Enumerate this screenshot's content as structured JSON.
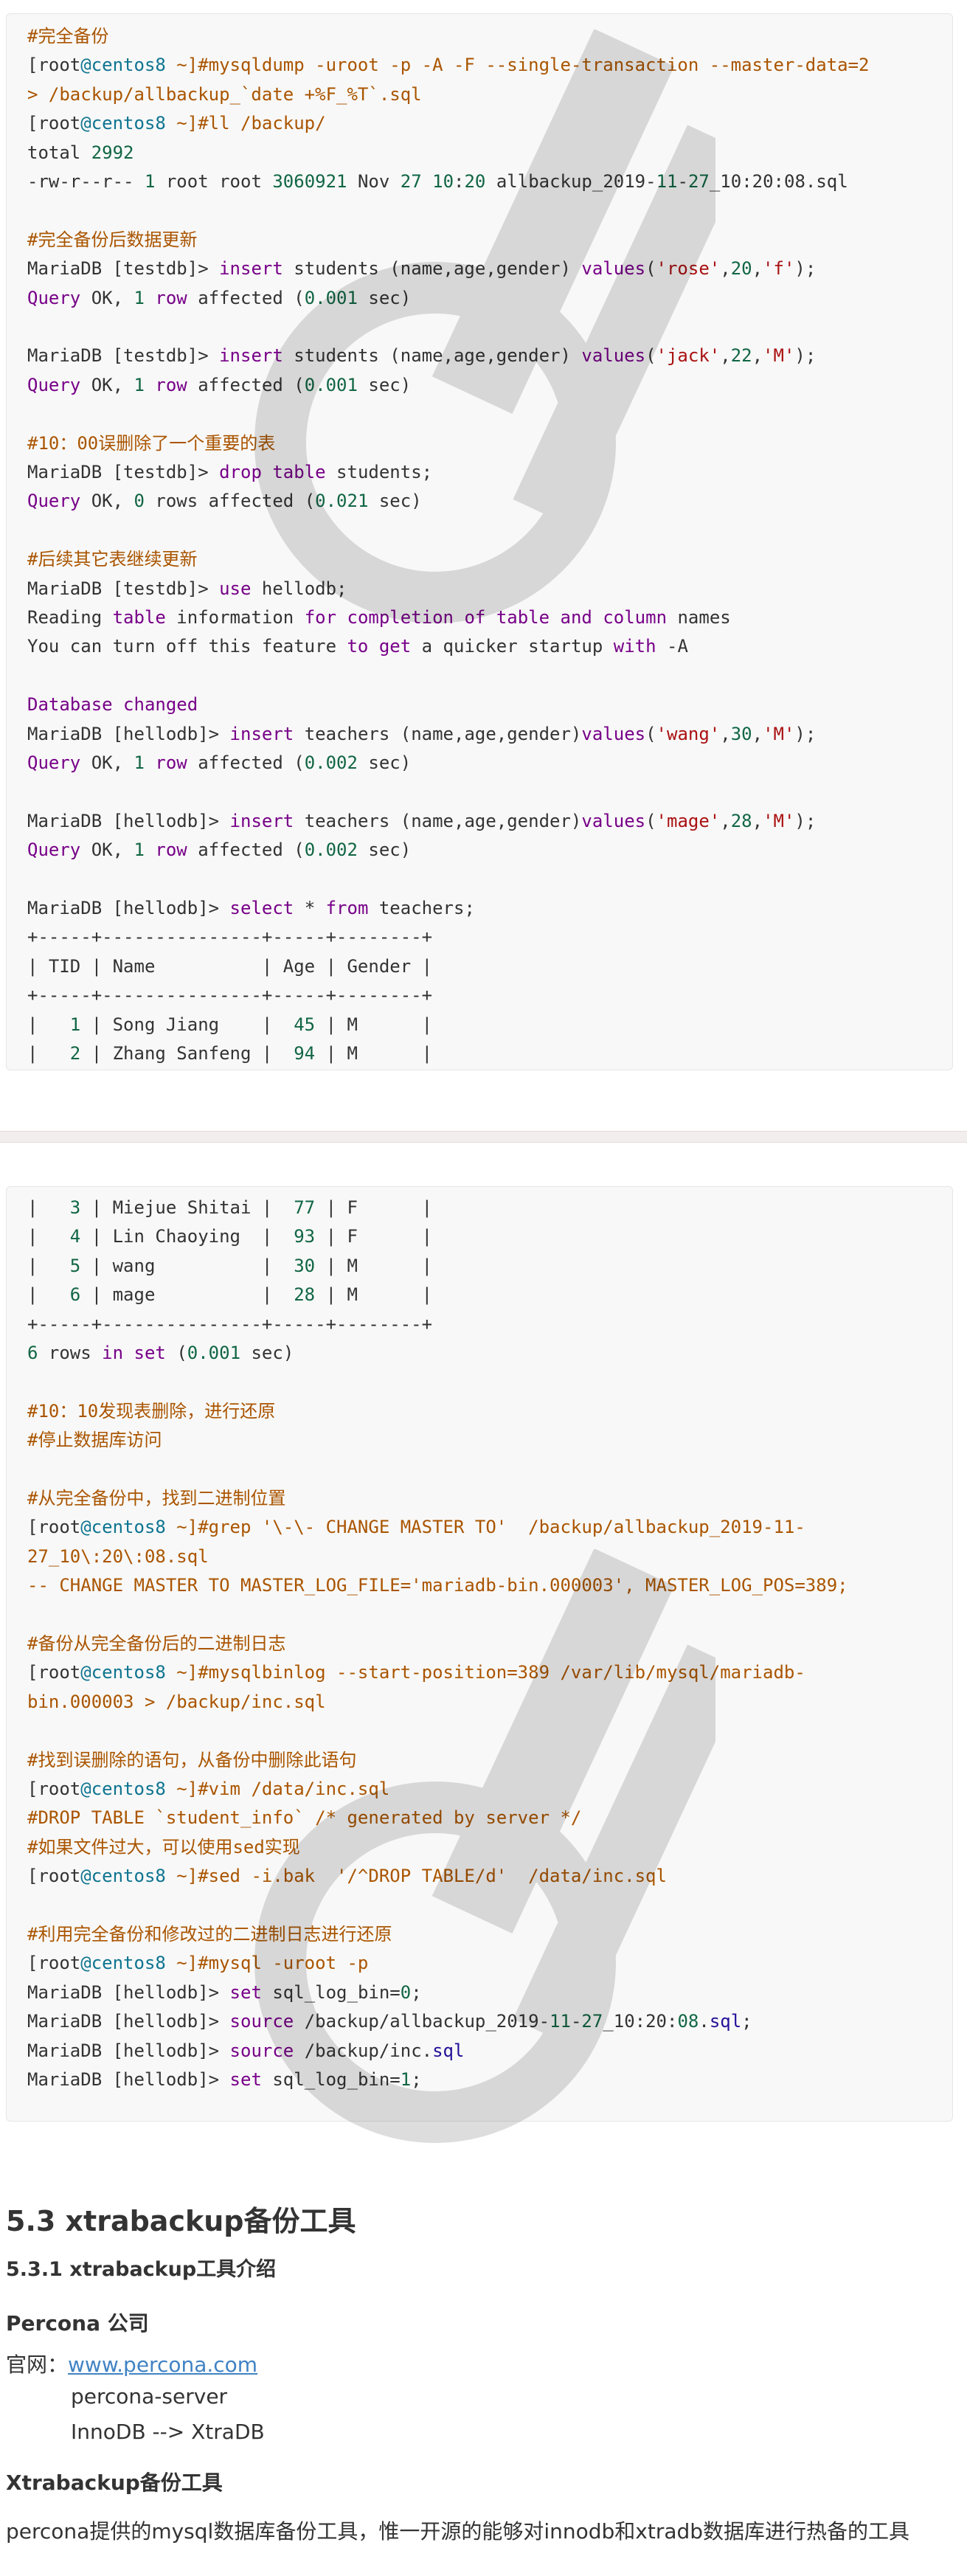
{
  "code_block_1": {
    "lines": [
      [
        [
          "c",
          "#完全备份"
        ]
      ],
      [
        [
          "",
          "[root"
        ],
        [
          "d",
          "@centos8"
        ],
        [
          "c",
          " ~]#mysqldump -uroot -p -A -F --single-transaction --master-data=2"
        ]
      ],
      [
        [
          "c",
          "> /backup/allbackup_`date +%F_%T`.sql"
        ]
      ],
      [
        [
          "",
          "[root"
        ],
        [
          "d",
          "@centos8"
        ],
        [
          "c",
          " ~]#ll /backup/"
        ]
      ],
      [
        [
          "",
          "total "
        ],
        [
          "n",
          "2992"
        ]
      ],
      [
        [
          "",
          "-rw-r--r-- "
        ],
        [
          "n",
          "1"
        ],
        [
          "",
          " root root "
        ],
        [
          "n",
          "3060921"
        ],
        [
          "",
          " Nov "
        ],
        [
          "n",
          "27"
        ],
        [
          "",
          " "
        ],
        [
          "n",
          "10"
        ],
        [
          "",
          ":"
        ],
        [
          "n",
          "20"
        ],
        [
          "",
          " allbackup_2019-"
        ],
        [
          "n",
          "11"
        ],
        [
          "",
          "-"
        ],
        [
          "n",
          "27"
        ],
        [
          "",
          "_10:20:08.sql"
        ]
      ],
      [
        [
          "",
          ""
        ]
      ],
      [
        [
          "c",
          "#完全备份后数据更新"
        ]
      ],
      [
        [
          "",
          "MariaDB [testdb]> "
        ],
        [
          "k",
          "insert"
        ],
        [
          "",
          " students (name,age,gender) "
        ],
        [
          "k",
          "values"
        ],
        [
          "",
          "("
        ],
        [
          "s",
          "'rose'"
        ],
        [
          "",
          ","
        ],
        [
          "n",
          "20"
        ],
        [
          "",
          ","
        ],
        [
          "s",
          "'f'"
        ],
        [
          "",
          ");"
        ]
      ],
      [
        [
          "k",
          "Query"
        ],
        [
          "",
          " OK, "
        ],
        [
          "n",
          "1"
        ],
        [
          "",
          ""
        ],
        [
          "k",
          " row"
        ],
        [
          "",
          " affected ("
        ],
        [
          "n",
          "0.001"
        ],
        [
          "",
          " sec)"
        ]
      ],
      [
        [
          "",
          ""
        ]
      ],
      [
        [
          "",
          "MariaDB [testdb]> "
        ],
        [
          "k",
          "insert"
        ],
        [
          "",
          " students (name,age,gender) "
        ],
        [
          "k",
          "values"
        ],
        [
          "",
          "("
        ],
        [
          "s",
          "'jack'"
        ],
        [
          "",
          ","
        ],
        [
          "n",
          "22"
        ],
        [
          "",
          ","
        ],
        [
          "s",
          "'M'"
        ],
        [
          "",
          ");"
        ]
      ],
      [
        [
          "k",
          "Query"
        ],
        [
          "",
          " OK, "
        ],
        [
          "n",
          "1"
        ],
        [
          "k",
          " row"
        ],
        [
          "",
          " affected ("
        ],
        [
          "n",
          "0.001"
        ],
        [
          "",
          " sec)"
        ]
      ],
      [
        [
          "",
          ""
        ]
      ],
      [
        [
          "c",
          "#10：00误删除了一个重要的表"
        ]
      ],
      [
        [
          "",
          "MariaDB [testdb]> "
        ],
        [
          "k",
          "drop"
        ],
        [
          "",
          " "
        ],
        [
          "k",
          "table"
        ],
        [
          "",
          " students;"
        ]
      ],
      [
        [
          "k",
          "Query"
        ],
        [
          "",
          " OK, "
        ],
        [
          "n",
          "0"
        ],
        [
          "",
          " rows affected ("
        ],
        [
          "n",
          "0.021"
        ],
        [
          "",
          " sec)"
        ]
      ],
      [
        [
          "",
          ""
        ]
      ],
      [
        [
          "c",
          "#后续其它表继续更新"
        ]
      ],
      [
        [
          "",
          "MariaDB [testdb]> "
        ],
        [
          "k",
          "use"
        ],
        [
          "",
          " hellodb;"
        ]
      ],
      [
        [
          "",
          "Reading "
        ],
        [
          "k",
          "table"
        ],
        [
          "",
          " information "
        ],
        [
          "k",
          "for"
        ],
        [
          "",
          " "
        ],
        [
          "k",
          "completion"
        ],
        [
          "",
          " "
        ],
        [
          "k",
          "of"
        ],
        [
          "",
          " "
        ],
        [
          "k",
          "table"
        ],
        [
          "",
          " "
        ],
        [
          "k",
          "and"
        ],
        [
          "",
          " "
        ],
        [
          "k",
          "column"
        ],
        [
          "",
          " names"
        ]
      ],
      [
        [
          "",
          "You can turn off this feature "
        ],
        [
          "k",
          "to"
        ],
        [
          "",
          " "
        ],
        [
          "k",
          "get"
        ],
        [
          "",
          " a quicker startup "
        ],
        [
          "k",
          "with"
        ],
        [
          "",
          " -A"
        ]
      ],
      [
        [
          "",
          ""
        ]
      ],
      [
        [
          "k",
          "Database"
        ],
        [
          "",
          " "
        ],
        [
          "k",
          "changed"
        ]
      ],
      [
        [
          "",
          "MariaDB [hellodb]> "
        ],
        [
          "k",
          "insert"
        ],
        [
          "",
          " teachers (name,age,gender)"
        ],
        [
          "k",
          "values"
        ],
        [
          "",
          "("
        ],
        [
          "s",
          "'wang'"
        ],
        [
          "",
          ","
        ],
        [
          "n",
          "30"
        ],
        [
          "",
          ","
        ],
        [
          "s",
          "'M'"
        ],
        [
          "",
          ");"
        ]
      ],
      [
        [
          "k",
          "Query"
        ],
        [
          "",
          " OK, "
        ],
        [
          "n",
          "1"
        ],
        [
          "k",
          " row"
        ],
        [
          "",
          " affected ("
        ],
        [
          "n",
          "0.002"
        ],
        [
          "",
          " sec)"
        ]
      ],
      [
        [
          "",
          ""
        ]
      ],
      [
        [
          "",
          "MariaDB [hellodb]> "
        ],
        [
          "k",
          "insert"
        ],
        [
          "",
          " teachers (name,age,gender)"
        ],
        [
          "k",
          "values"
        ],
        [
          "",
          "("
        ],
        [
          "s",
          "'mage'"
        ],
        [
          "",
          ","
        ],
        [
          "n",
          "28"
        ],
        [
          "",
          ","
        ],
        [
          "s",
          "'M'"
        ],
        [
          "",
          ");"
        ]
      ],
      [
        [
          "k",
          "Query"
        ],
        [
          "",
          " OK, "
        ],
        [
          "n",
          "1"
        ],
        [
          "k",
          " row"
        ],
        [
          "",
          " affected ("
        ],
        [
          "n",
          "0.002"
        ],
        [
          "",
          " sec)"
        ]
      ],
      [
        [
          "",
          ""
        ]
      ],
      [
        [
          "",
          "MariaDB [hellodb]> "
        ],
        [
          "k",
          "select"
        ],
        [
          "",
          " * "
        ],
        [
          "k",
          "from"
        ],
        [
          "",
          " teachers;"
        ]
      ],
      [
        [
          "",
          "+-----+---------------+-----+--------+"
        ]
      ],
      [
        [
          "",
          "| TID | Name          | Age | Gender |"
        ]
      ],
      [
        [
          "",
          "+-----+---------------+-----+--------+"
        ]
      ],
      [
        [
          "",
          "|   "
        ],
        [
          "n",
          "1"
        ],
        [
          "",
          " | Song Jiang    |  "
        ],
        [
          "n",
          "45"
        ],
        [
          "",
          " | M      |"
        ]
      ],
      [
        [
          "",
          "|   "
        ],
        [
          "n",
          "2"
        ],
        [
          "",
          " | Zhang Sanfeng |  "
        ],
        [
          "n",
          "94"
        ],
        [
          "",
          " | M      |"
        ]
      ]
    ]
  },
  "code_block_2": {
    "lines": [
      [
        [
          "",
          "|   "
        ],
        [
          "n",
          "3"
        ],
        [
          "",
          " | Miejue Shitai |  "
        ],
        [
          "n",
          "77"
        ],
        [
          "",
          " | F      |"
        ]
      ],
      [
        [
          "",
          "|   "
        ],
        [
          "n",
          "4"
        ],
        [
          "",
          " | Lin Chaoying  |  "
        ],
        [
          "n",
          "93"
        ],
        [
          "",
          " | F      |"
        ]
      ],
      [
        [
          "",
          "|   "
        ],
        [
          "n",
          "5"
        ],
        [
          "",
          " | wang          |  "
        ],
        [
          "n",
          "30"
        ],
        [
          "",
          " | M      |"
        ]
      ],
      [
        [
          "",
          "|   "
        ],
        [
          "n",
          "6"
        ],
        [
          "",
          " | mage          |  "
        ],
        [
          "n",
          "28"
        ],
        [
          "",
          " | M      |"
        ]
      ],
      [
        [
          "",
          "+-----+---------------+-----+--------+"
        ]
      ],
      [
        [
          "n",
          "6"
        ],
        [
          "",
          " rows "
        ],
        [
          "k",
          "in"
        ],
        [
          "",
          " "
        ],
        [
          "k",
          "set"
        ],
        [
          "",
          " ("
        ],
        [
          "n",
          "0.001"
        ],
        [
          "",
          " sec)"
        ]
      ],
      [
        [
          "",
          ""
        ]
      ],
      [
        [
          "c",
          "#10：10发现表删除，进行还原"
        ]
      ],
      [
        [
          "c",
          "#停止数据库访问"
        ]
      ],
      [
        [
          "",
          ""
        ]
      ],
      [
        [
          "c",
          "#从完全备份中，找到二进制位置"
        ]
      ],
      [
        [
          "",
          "[root"
        ],
        [
          "d",
          "@centos8"
        ],
        [
          "c",
          " ~]#grep '\\-\\- CHANGE MASTER TO'  /backup/allbackup_2019-11-"
        ]
      ],
      [
        [
          "c",
          "27_10\\:20\\:08.sql"
        ]
      ],
      [
        [
          "c",
          "-- CHANGE MASTER TO MASTER_LOG_FILE='mariadb-bin.000003', MASTER_LOG_POS=389;"
        ]
      ],
      [
        [
          "",
          ""
        ]
      ],
      [
        [
          "c",
          "#备份从完全备份后的二进制日志"
        ]
      ],
      [
        [
          "",
          "[root"
        ],
        [
          "d",
          "@centos8"
        ],
        [
          "c",
          " ~]#mysqlbinlog --start-position=389 /var/lib/mysql/mariadb-"
        ]
      ],
      [
        [
          "c",
          "bin.000003 > /backup/inc.sql"
        ]
      ],
      [
        [
          "",
          ""
        ]
      ],
      [
        [
          "c",
          "#找到误删除的语句，从备份中删除此语句"
        ]
      ],
      [
        [
          "",
          "[root"
        ],
        [
          "d",
          "@centos8"
        ],
        [
          "c",
          " ~]#vim /data/inc.sql"
        ]
      ],
      [
        [
          "c",
          "#DROP TABLE `student_info` /* generated by server */"
        ]
      ],
      [
        [
          "c",
          "#如果文件过大，可以使用sed实现"
        ]
      ],
      [
        [
          "",
          "[root"
        ],
        [
          "d",
          "@centos8"
        ],
        [
          "c",
          " ~]#sed -i.bak  '/^DROP TABLE/d'  /data/inc.sql"
        ]
      ],
      [
        [
          "",
          ""
        ]
      ],
      [
        [
          "c",
          "#利用完全备份和修改过的二进制日志进行还原"
        ]
      ],
      [
        [
          "",
          "[root"
        ],
        [
          "d",
          "@centos8"
        ],
        [
          "c",
          " ~]#mysql -uroot -p"
        ]
      ],
      [
        [
          "",
          "MariaDB [hellodb]> "
        ],
        [
          "k",
          "set"
        ],
        [
          "",
          " sql_log_bin="
        ],
        [
          "n",
          "0"
        ],
        [
          "",
          ";"
        ]
      ],
      [
        [
          "",
          "MariaDB [hellodb]> "
        ],
        [
          "k",
          "source"
        ],
        [
          "",
          " /backup/allbackup_2019-"
        ],
        [
          "n",
          "11"
        ],
        [
          "",
          "-"
        ],
        [
          "n",
          "27"
        ],
        [
          "",
          "_10:20:"
        ],
        [
          "n",
          "08"
        ],
        [
          "",
          "."
        ],
        [
          "u",
          "sql"
        ],
        [
          "",
          ";"
        ]
      ],
      [
        [
          "",
          "MariaDB [hellodb]> "
        ],
        [
          "k",
          "source"
        ],
        [
          "",
          " /backup/inc."
        ],
        [
          "u",
          "sql"
        ]
      ],
      [
        [
          "",
          "MariaDB [hellodb]> "
        ],
        [
          "k",
          "set"
        ],
        [
          "",
          " sql_log_bin="
        ],
        [
          "n",
          "1"
        ],
        [
          "",
          ";"
        ]
      ]
    ]
  },
  "doc": {
    "section_title": "5.3 xtrabackup备份工具",
    "subsection_title": "5.3.1 xtrabackup工具介绍",
    "company_heading": "Percona 公司",
    "site_label": "官网：",
    "site_link": "www.percona.com",
    "item_1": "percona-server",
    "item_2": "InnoDB --> XtraDB",
    "tool_heading": "Xtrabackup备份工具",
    "tool_desc": "percona提供的mysql数据库备份工具，惟一开源的能够对innodb和xtradb数据库进行热备的工具"
  },
  "colors": {
    "keyword": "#770088",
    "comment": "#aa5500",
    "number": "#116644",
    "string": "#aa1111",
    "host": "#ef6c00",
    "link": "#4183c4"
  }
}
